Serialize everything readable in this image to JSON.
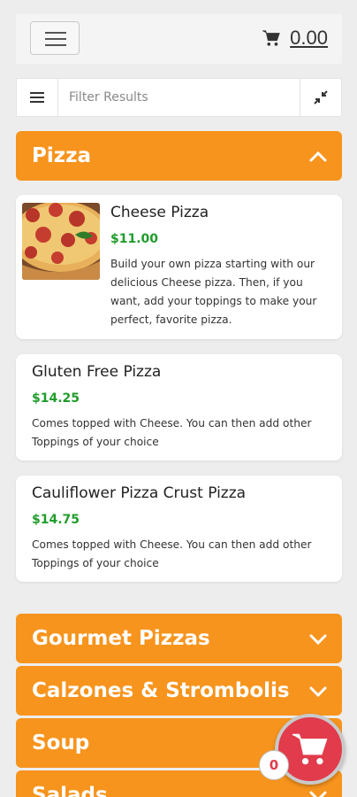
{
  "header": {
    "menu_icon": "hamburger-menu-icon",
    "cart_icon": "shopping-cart-icon",
    "cart_total": "0.00"
  },
  "filter": {
    "list_icon": "list-icon",
    "placeholder": "Filter Results",
    "collapse_icon": "collapse-arrows-icon"
  },
  "categories": [
    {
      "name": "Pizza",
      "expanded": true,
      "items": [
        {
          "name": "Cheese Pizza",
          "price": "$11.00",
          "description": "Build your own pizza starting with our delicious Cheese pizza. Then, if you want, add your toppings to make your perfect, favorite pizza.",
          "has_image": true
        },
        {
          "name": "Gluten Free Pizza",
          "price": "$14.25",
          "description": "Comes topped with Cheese. You can then add other Toppings of your choice"
        },
        {
          "name": "Cauliflower Pizza Crust Pizza",
          "price": "$14.75",
          "description": "Comes topped with Cheese. You can then add other Toppings of your choice"
        }
      ]
    },
    {
      "name": "Gourmet Pizzas",
      "expanded": false
    },
    {
      "name": "Calzones & Strombolis",
      "expanded": false
    },
    {
      "name": "Soup",
      "expanded": false
    },
    {
      "name": "Salads",
      "expanded": false
    }
  ],
  "floating_cart": {
    "icon": "shopping-cart-icon",
    "count": "0"
  },
  "colors": {
    "accent": "#f7941d",
    "price": "#1f9d2b",
    "cart_button": "#e23b4c"
  }
}
